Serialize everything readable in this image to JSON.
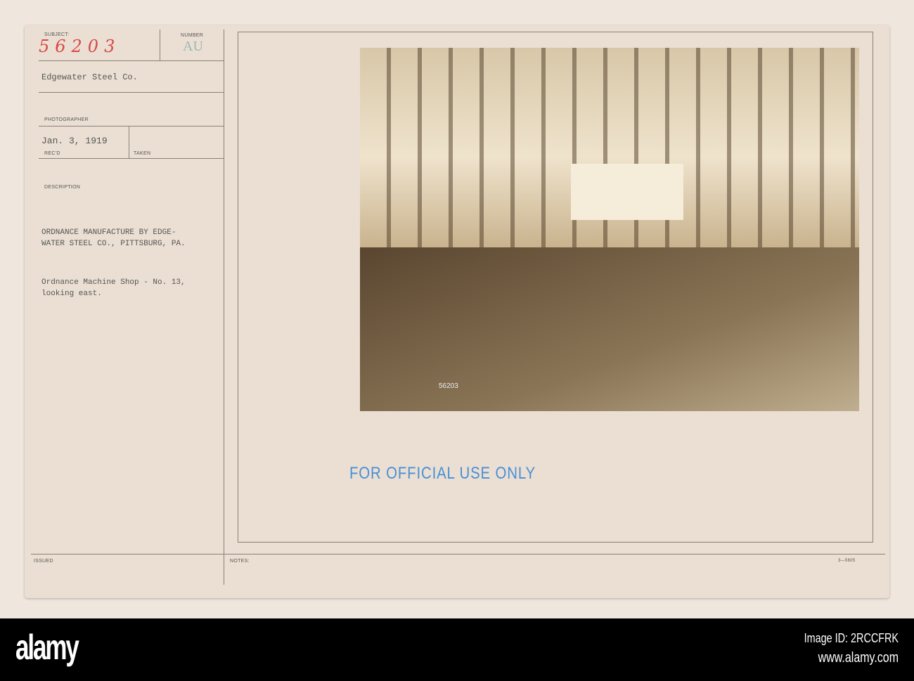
{
  "card": {
    "subject_label": "SUBJECT:",
    "subject_number": "56203",
    "number_label": "NUMBER",
    "number_value": "AU",
    "subject_text": "Edgewater Steel Co.",
    "photographer_label": "PHOTOGRAPHER",
    "recd_date": "Jan. 3, 1919",
    "recd_label": "REC'D",
    "taken_label": "TAKEN",
    "description_label": "DESCRIPTION",
    "description_lines": [
      "ORDNANCE MANUFACTURE BY EDGE-",
      "WATER STEEL CO., PITTSBURG, PA."
    ],
    "caption_lines": [
      "Ordnance Machine Shop - No. 13,",
      "looking east."
    ],
    "issued_label": "ISSUED",
    "notes_label": "NOTES:",
    "form_number": "3—5605",
    "photo_number": "56203",
    "stamp": "FOR OFFICIAL USE ONLY"
  },
  "footer": {
    "logo": "alamy",
    "image_id": "Image ID: 2RCCFRK",
    "url": "www.alamy.com"
  }
}
